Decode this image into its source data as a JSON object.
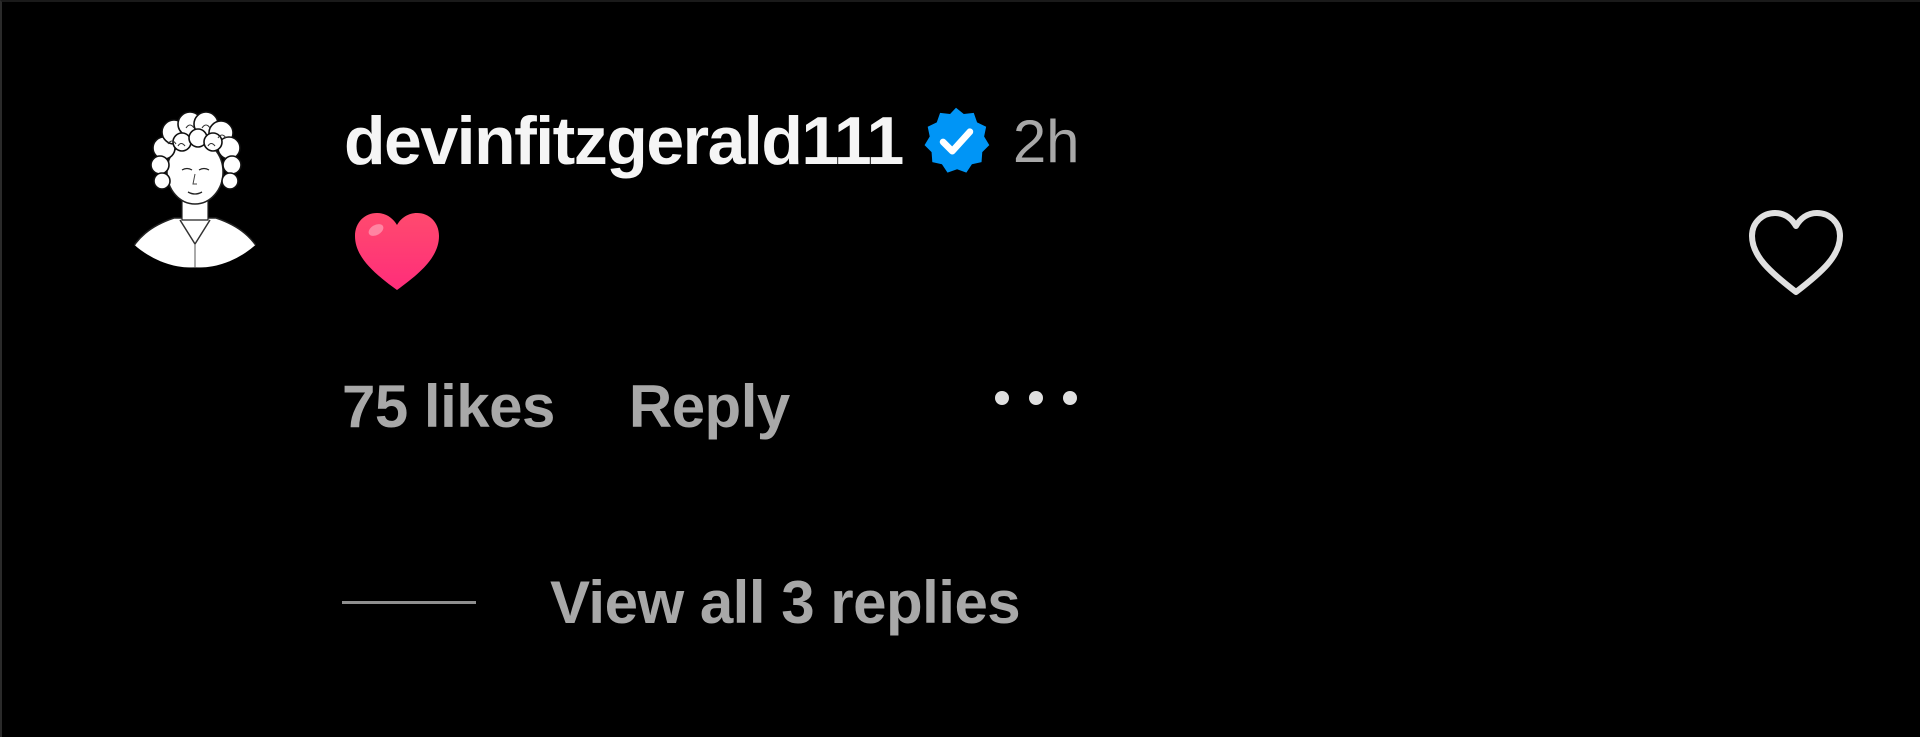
{
  "comment": {
    "username": "devinfitzgerald111",
    "verified": true,
    "time_ago": "2h",
    "body_icon": "red-heart-emoji",
    "likes_text": "75 likes",
    "reply_label": "Reply",
    "more_icon": "more-horizontal-icon",
    "like_icon": "heart-outline-icon",
    "view_replies_label": "View all 3 replies"
  },
  "colors": {
    "background": "#000000",
    "primary_text": "#f5f5f5",
    "secondary_text": "#a8a8a8",
    "verified_blue": "#0095f6",
    "heart_red": "#ff2d55"
  }
}
